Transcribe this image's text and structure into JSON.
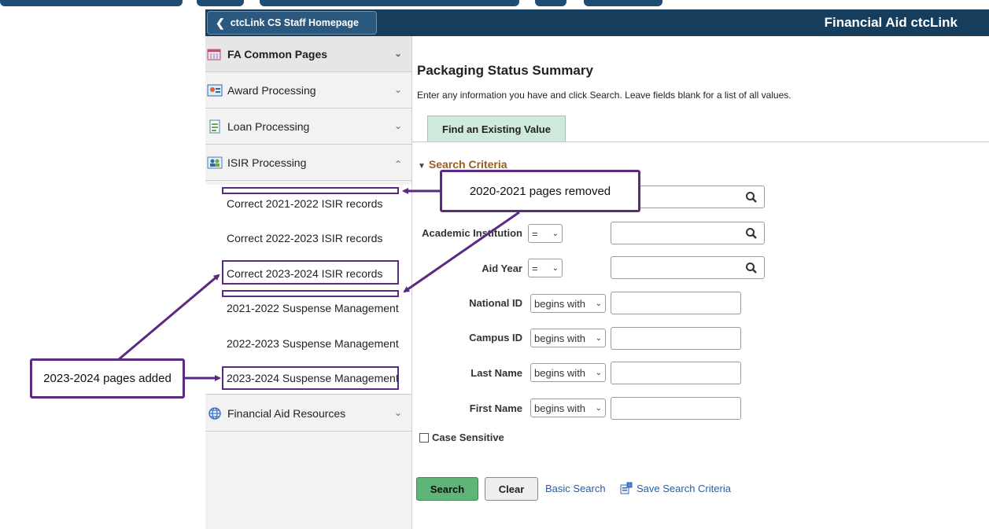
{
  "header": {
    "home_button_label": "ctcLink CS Staff Homepage",
    "app_title": "Financial Aid ctcLink"
  },
  "sidebar": {
    "groups": [
      {
        "label": "FA Common Pages",
        "icon": "calendar-icon",
        "expanded": false
      },
      {
        "label": "Award Processing",
        "icon": "award-icon",
        "expanded": false
      },
      {
        "label": "Loan Processing",
        "icon": "document-icon",
        "expanded": false
      },
      {
        "label": "ISIR Processing",
        "icon": "people-icon",
        "expanded": true
      },
      {
        "label": "Financial Aid Resources",
        "icon": "globe-icon",
        "expanded": false
      }
    ],
    "isir_items": [
      "Correct 2021-2022 ISIR records",
      "Correct 2022-2023 ISIR records",
      "Correct 2023-2024 ISIR records",
      "2021-2022 Suspense Management",
      "2022-2023 Suspense Management",
      "2023-2024 Suspense Management"
    ]
  },
  "main": {
    "title": "Packaging Status Summary",
    "instructions": "Enter any information you have and click Search. Leave fields blank for a list of all values.",
    "tab_label": "Find an Existing Value",
    "criteria_label": "Search Criteria",
    "fields": [
      {
        "label": "",
        "operator": ""
      },
      {
        "label": "Academic Institution",
        "operator": "="
      },
      {
        "label": "Aid Year",
        "operator": "="
      },
      {
        "label": "National ID",
        "operator": "begins with"
      },
      {
        "label": "Campus ID",
        "operator": "begins with"
      },
      {
        "label": "Last Name",
        "operator": "begins with"
      },
      {
        "label": "First Name",
        "operator": "begins with"
      }
    ],
    "case_sensitive_label": "Case Sensitive",
    "search_label": "Search",
    "clear_label": "Clear",
    "basic_search_label": "Basic Search",
    "save_criteria_label": "Save Search Criteria"
  },
  "annotations": {
    "removed": "2020-2021 pages removed",
    "added": "2023-2024 pages added",
    "color": "#5a2a82"
  },
  "colors": {
    "header_bg": "#173d5d",
    "tab_bg": "#cfe9dc",
    "search_button": "#5fb577",
    "criteria_text": "#9c5d1b",
    "link": "#1f5fb2"
  }
}
